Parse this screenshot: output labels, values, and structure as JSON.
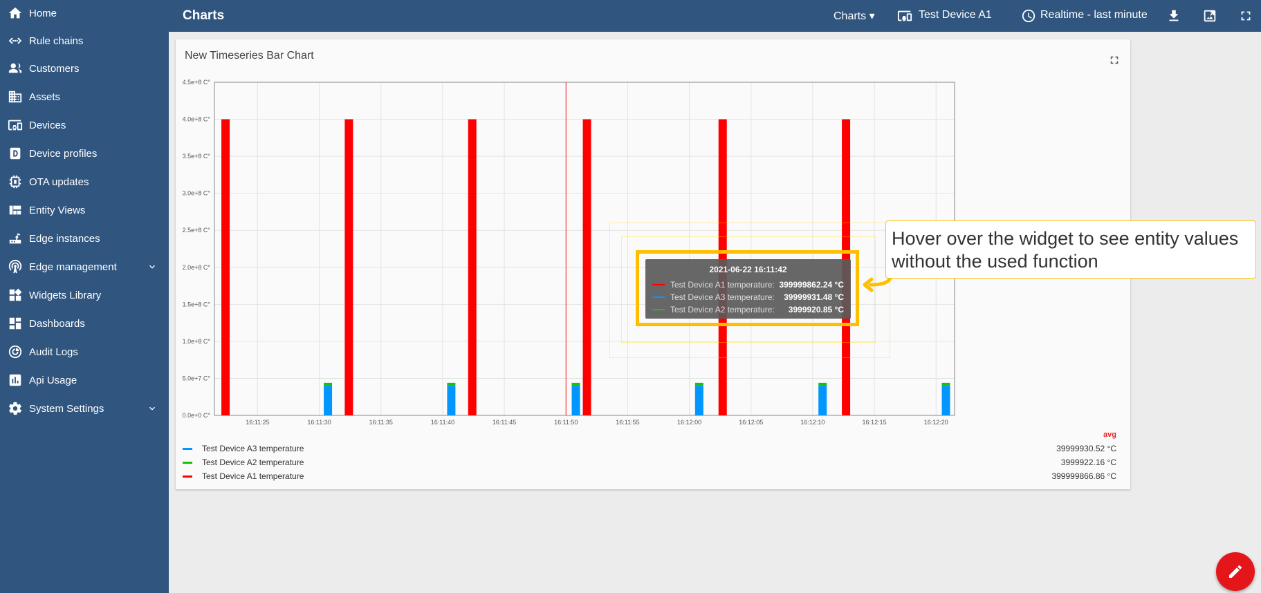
{
  "sidebar": {
    "items": [
      {
        "label": "Home",
        "icon": "home-icon"
      },
      {
        "label": "Rule chains",
        "icon": "rule-chains-icon"
      },
      {
        "label": "Customers",
        "icon": "customers-icon"
      },
      {
        "label": "Assets",
        "icon": "assets-icon"
      },
      {
        "label": "Devices",
        "icon": "devices-icon"
      },
      {
        "label": "Device profiles",
        "icon": "device-profiles-icon"
      },
      {
        "label": "OTA updates",
        "icon": "ota-updates-icon"
      },
      {
        "label": "Entity Views",
        "icon": "entity-views-icon"
      },
      {
        "label": "Edge instances",
        "icon": "edge-instances-icon"
      },
      {
        "label": "Edge management",
        "icon": "edge-management-icon",
        "expandable": true
      },
      {
        "label": "Widgets Library",
        "icon": "widgets-library-icon"
      },
      {
        "label": "Dashboards",
        "icon": "dashboards-icon"
      },
      {
        "label": "Audit Logs",
        "icon": "audit-logs-icon"
      },
      {
        "label": "Api Usage",
        "icon": "api-usage-icon"
      },
      {
        "label": "System Settings",
        "icon": "system-settings-icon",
        "expandable": true
      }
    ]
  },
  "topbar": {
    "title": "Charts",
    "state_selector": "Charts",
    "entity": "Test Device A1",
    "timewindow": "Realtime - last minute"
  },
  "widget": {
    "title": "New Timeseries Bar Chart"
  },
  "chart_data": {
    "type": "bar",
    "y_ticks": [
      "0.0e+0 C°",
      "5.0e+7 C°",
      "1.0e+8 C°",
      "1.5e+8 C°",
      "2.0e+8 C°",
      "2.5e+8 C°",
      "3.0e+8 C°",
      "3.5e+8 C°",
      "4.0e+8 C°",
      "4.5e+8 C°"
    ],
    "ylim": [
      0,
      450000000
    ],
    "x_ticks": [
      "16:11:25",
      "16:11:30",
      "16:11:35",
      "16:11:40",
      "16:11:45",
      "16:11:50",
      "16:11:55",
      "16:12:00",
      "16:12:05",
      "16:12:10",
      "16:12:15",
      "16:12:20"
    ],
    "x_tick_seconds": [
      25,
      30,
      35,
      40,
      45,
      50,
      55,
      60,
      65,
      70,
      75,
      80
    ],
    "xlim_seconds": [
      21.5,
      81.5
    ],
    "series": [
      {
        "name": "Test Device A1 temperature",
        "color": "#ff0000",
        "x_seconds": [
          22.4,
          32.4,
          42.4,
          51.7,
          62.7,
          72.7
        ],
        "values": [
          400000000,
          400000000,
          400000000,
          400000000,
          400000000,
          400000000
        ]
      },
      {
        "name": "Test Device A3 temperature",
        "color": "#0496ff",
        "x_seconds": [
          30.7,
          40.7,
          50.8,
          60.8,
          70.8,
          80.8
        ],
        "values": [
          40000000,
          40000000,
          40000000,
          40000000,
          40000000,
          40000000
        ]
      },
      {
        "name": "Test Device A2 temperature",
        "color": "#17c20e",
        "x_seconds": [
          30.7,
          40.7,
          50.8,
          60.8,
          70.8,
          80.8
        ],
        "values": [
          4000000,
          4000000,
          4000000,
          4000000,
          4000000,
          4000000
        ]
      }
    ],
    "crosshair_seconds": 50.0,
    "grid": true
  },
  "legend": {
    "header": "avg",
    "entries": [
      {
        "name": "Test Device A3 temperature",
        "color": "#0496ff",
        "avg": "39999930.52 °C"
      },
      {
        "name": "Test Device A2 temperature",
        "color": "#17c20e",
        "avg": "3999922.16 °C"
      },
      {
        "name": "Test Device A1 temperature",
        "color": "#ff0000",
        "avg": "399999866.86 °C"
      }
    ]
  },
  "tooltip": {
    "date": "2021-06-22 16:11:42",
    "rows": [
      {
        "name": "Test Device A1 temperature:",
        "value": "399999862.24 °C",
        "color": "#ff0000"
      },
      {
        "name": "Test Device A3 temperature:",
        "value": "39999931.48 °C",
        "color": "#0496ff"
      },
      {
        "name": "Test Device A2 temperature:",
        "value": "3999920.85 °C",
        "color": "#17c20e"
      }
    ]
  },
  "callout": {
    "text": "Hover over the widget to see entity values without the used function"
  },
  "colors": {
    "primary": "#305680",
    "accent": "#e4161a",
    "highlight": "#ffbf00"
  }
}
